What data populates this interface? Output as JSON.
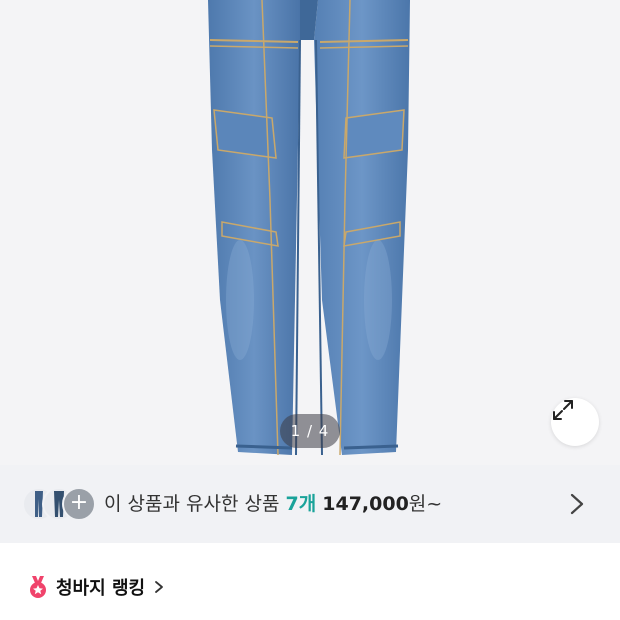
{
  "gallery": {
    "counter": "1 / 4",
    "current": 1,
    "total": 4,
    "product": "jeans-photo",
    "expand_icon": "expand-icon"
  },
  "similar": {
    "lead": "이 상품과 유사한 상품",
    "count": "7개",
    "price": "147,000",
    "suffix": "원~",
    "plus": "+",
    "accent_color": "#1aa39a"
  },
  "ranking": {
    "title": "청바지 랭킹",
    "icon": "ranking-medal-icon",
    "icon_color": "#f0436b"
  }
}
